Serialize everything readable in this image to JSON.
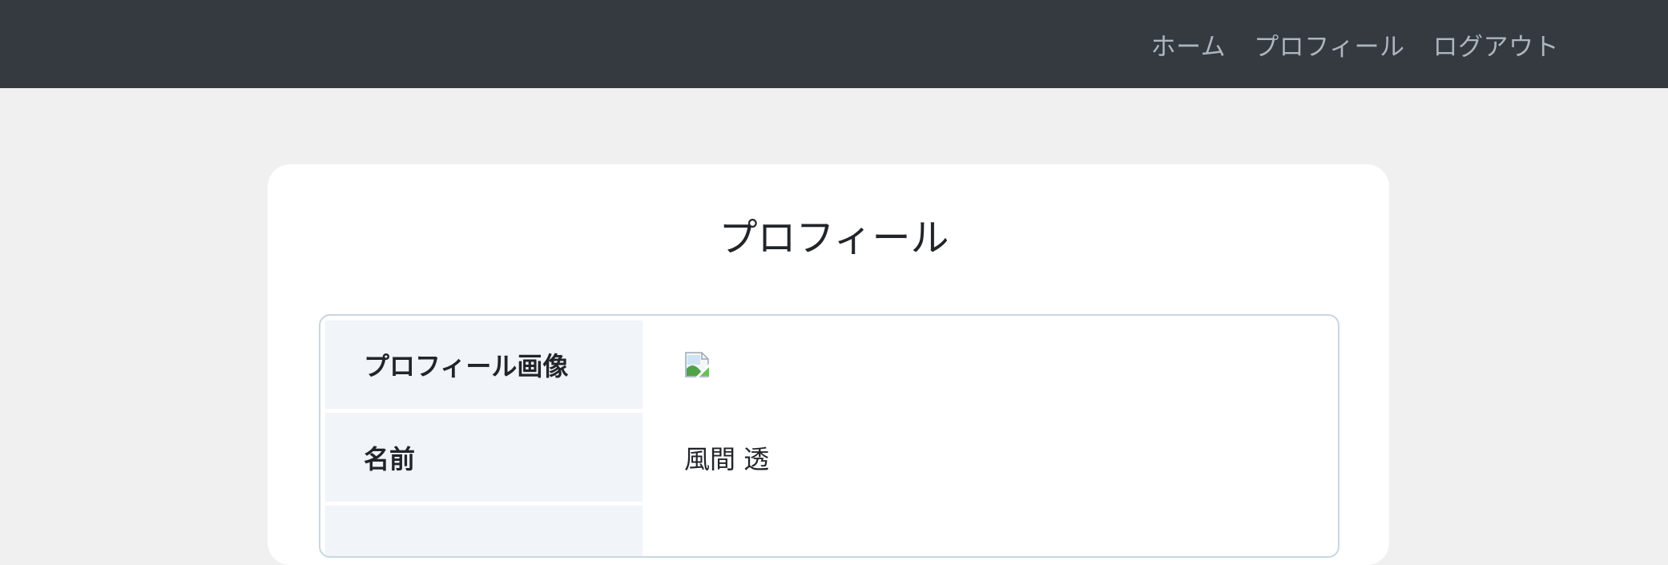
{
  "nav": {
    "home": "ホーム",
    "profile": "プロフィール",
    "logout": "ログアウト"
  },
  "page": {
    "title": "プロフィール"
  },
  "profile_table": {
    "rows": [
      {
        "label": "プロフィール画像",
        "value": "",
        "icon": "broken-image-icon"
      },
      {
        "label": "名前",
        "value": "風間 透"
      },
      {
        "label": "",
        "value": ""
      }
    ]
  },
  "colors": {
    "navbar": "#343a40",
    "nav_link": "#adb5bd",
    "background": "#f0f0f0",
    "card": "#ffffff",
    "label_cell": "#f1f4f8",
    "table_border": "#c8d6e0"
  }
}
